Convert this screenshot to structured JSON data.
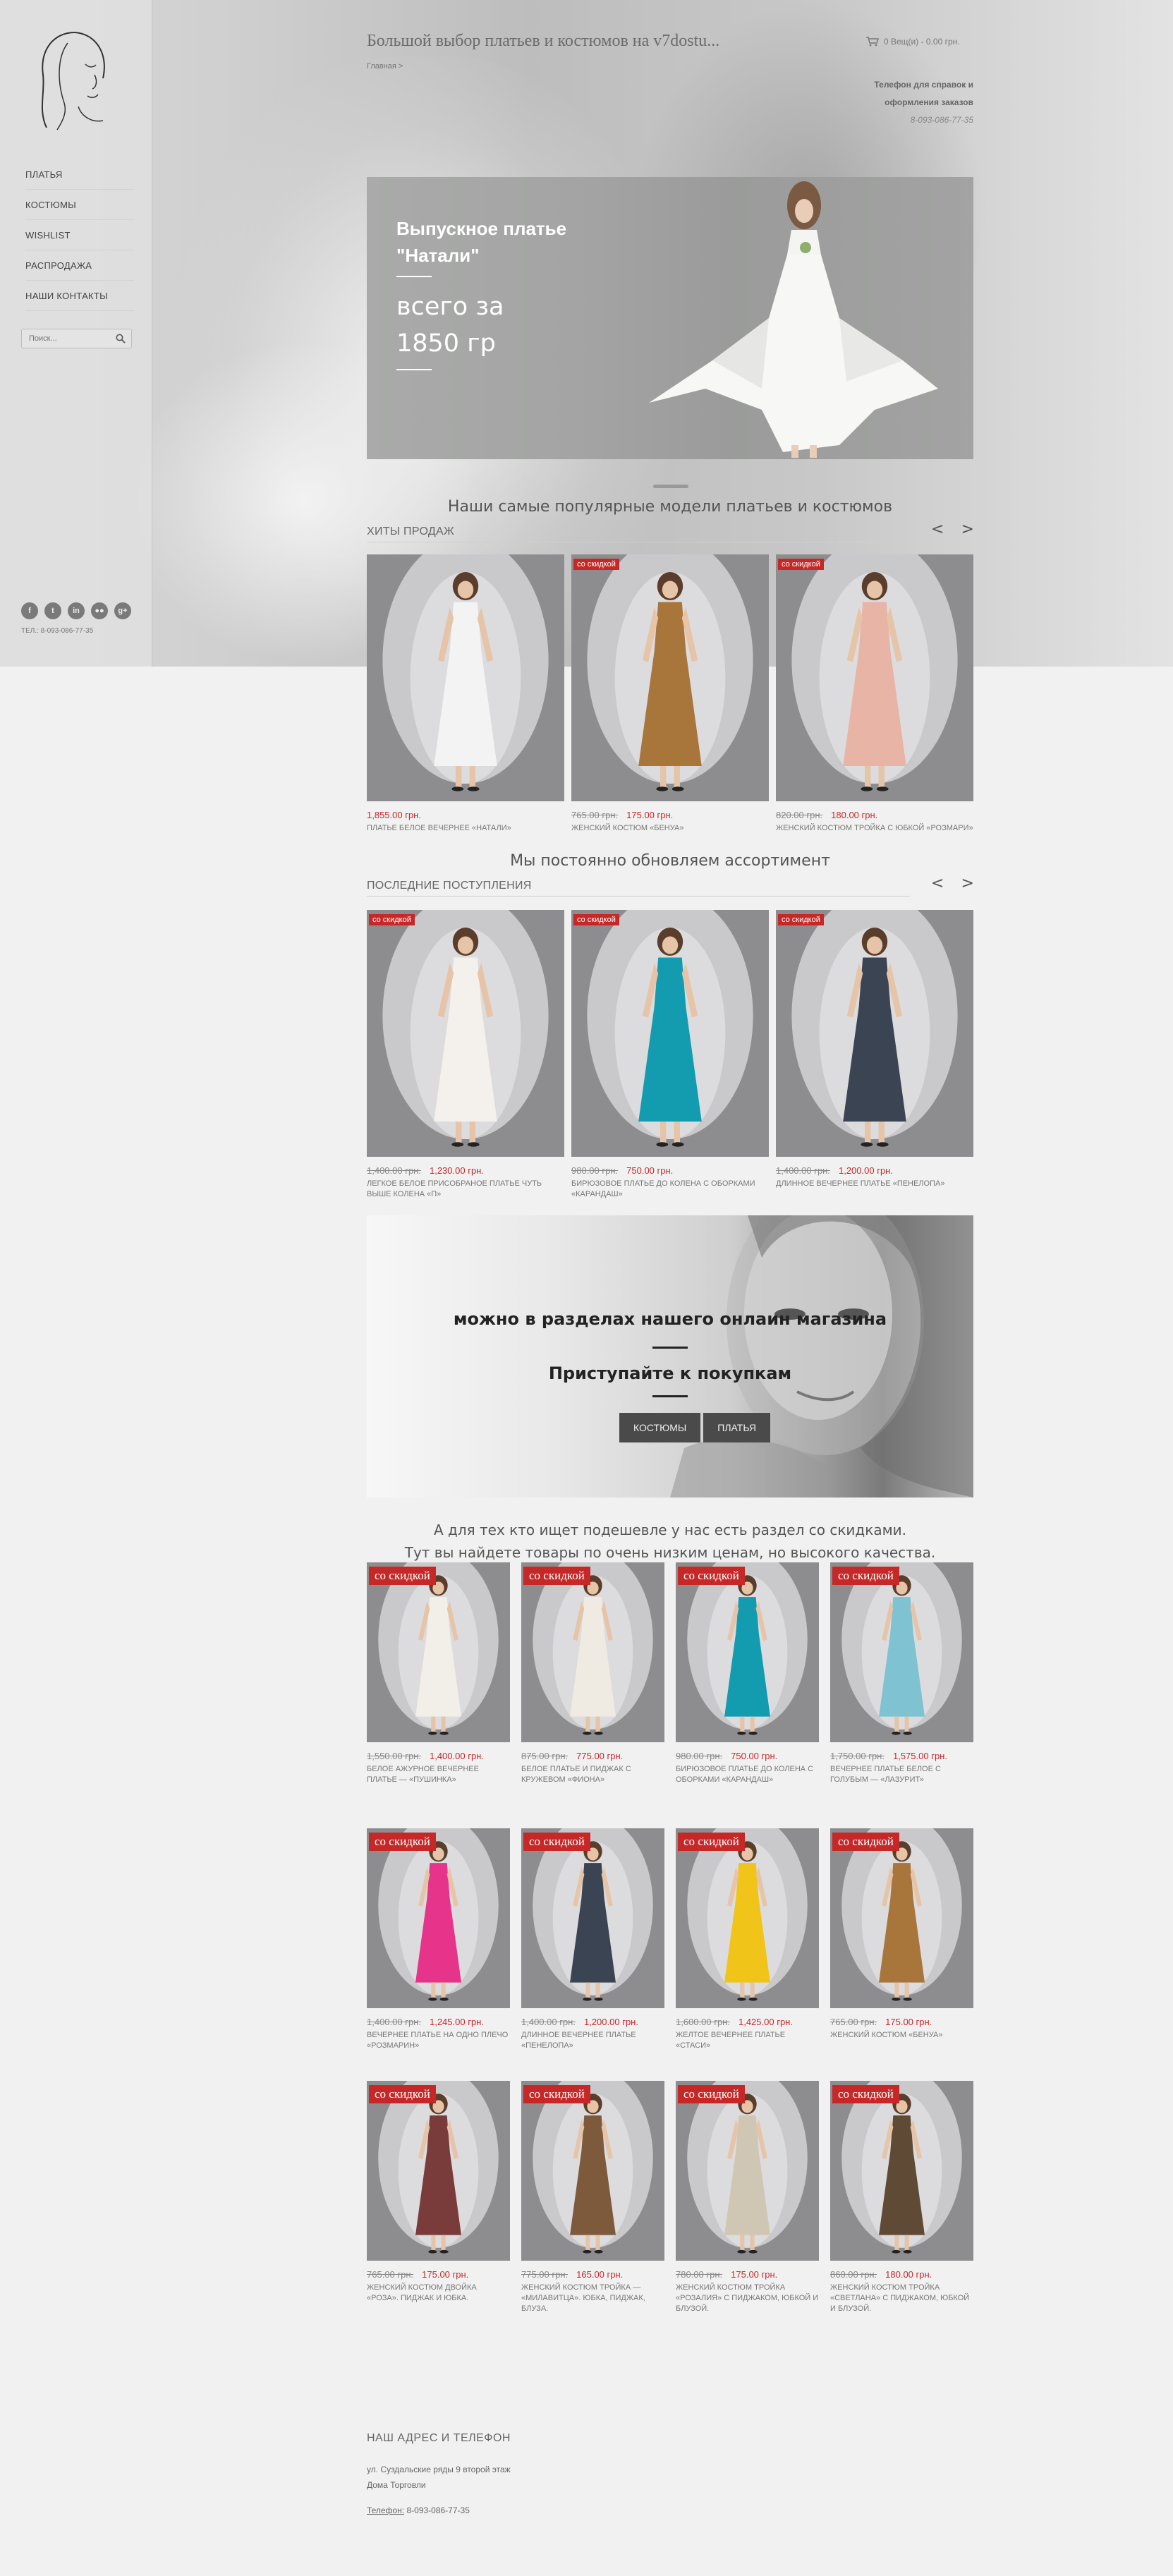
{
  "sidebar": {
    "nav": [
      "ПЛАТЬЯ",
      "КОСТЮМЫ",
      "WISHLIST",
      "РАСПРОДАЖА",
      "НАШИ КОНТАКТЫ"
    ],
    "search_placeholder": "Поиск...",
    "socials": [
      "f",
      "t",
      "in",
      "●●",
      "g+"
    ],
    "phone": "ТЕЛ.: 8-093-086-77-35"
  },
  "header": {
    "title": "Большой выбор платьев и костюмов на v7dostu...",
    "breadcrumb": "Главная  >",
    "cart": "0 Вещ(и) - 0.00 грн.",
    "help_line1": "Телефон для справок и",
    "help_line2": "оформления заказов",
    "help_phone": "8-093-086-77-35"
  },
  "banner": {
    "title_line1": "Выпускное платье",
    "title_line2": "\"Натали\"",
    "price_line1": "всего за",
    "price_line2": "1850 гр"
  },
  "popular": {
    "heading": "Наши самые популярные модели платьев и костюмов",
    "label": "ХИТЫ ПРОДАЖ",
    "items": [
      {
        "badge": "",
        "old": "",
        "price": "1,855.00 грн.",
        "name": "ПЛАТЬЕ БЕЛОЕ ВЕЧЕРНЕЕ «НАТАЛИ»",
        "color": "#f3f3f3"
      },
      {
        "badge": "со скидкой",
        "old": "765.00 грн.",
        "price": "175.00 грн.",
        "name": "ЖЕНСКИЙ КОСТЮМ «БЕНУА»",
        "color": "#a8753a"
      },
      {
        "badge": "со скидкой",
        "old": "820.00 грн.",
        "price": "180.00 грн.",
        "name": "ЖЕНСКИЙ КОСТЮМ ТРОЙКА С ЮБКОЙ «РОЗМАРИ»",
        "color": "#e8b4a6"
      }
    ]
  },
  "latest": {
    "heading": "Мы постоянно обновляем ассортимент",
    "label": "ПОСЛЕДНИЕ ПОСТУПЛЕНИЯ",
    "items": [
      {
        "badge": "со скидкой",
        "old": "1,400.00 грн.",
        "price": "1,230.00 грн.",
        "name": "ЛЕГКОЕ БЕЛОЕ ПРИСОБРАНОЕ ПЛАТЬЕ ЧУТЬ ВЫШЕ КОЛЕНА «П»",
        "color": "#f4f1ec"
      },
      {
        "badge": "со скидкой",
        "old": "980.00 грн.",
        "price": "750.00 грн.",
        "name": "БИРЮЗОВОЕ ПЛАТЬЕ ДО КОЛЕНА С ОБОРКАМИ «КАРАНДАШ»",
        "color": "#139bb0"
      },
      {
        "badge": "со скидкой",
        "old": "1,400.00 грн.",
        "price": "1,200.00 грн.",
        "name": "ДЛИННОЕ ВЕЧЕРНЕЕ ПЛАТЬЕ «ПЕНЕЛОПА»",
        "color": "#3b4452"
      }
    ]
  },
  "promo": {
    "line1": "можно в разделах нашего онлайн магазина",
    "line2": "Приступайте к покупкам",
    "btn1": "КОСТЮМЫ",
    "btn2": "ПЛАТЬЯ"
  },
  "discounts": {
    "heading1": "А для тех кто ищет подешевле у нас есть раздел со скидками.",
    "heading2": "Тут вы найдете товары по очень низким ценам, но высокого качества.",
    "items": [
      {
        "badge": "со скидкой",
        "old": "1,550.00 грн.",
        "price": "1,400.00 грн.",
        "name": "БЕЛОЕ АЖУРНОЕ ВЕЧЕРНЕЕ ПЛАТЬЕ — «ПУШИНКА»",
        "color": "#f2efe8"
      },
      {
        "badge": "со скидкой",
        "old": "875.00 грн.",
        "price": "775.00 грн.",
        "name": "БЕЛОЕ ПЛАТЬЕ И ПИДЖАК С КРУЖЕВОМ «ФИОНА»",
        "color": "#f0ebe2"
      },
      {
        "badge": "со скидкой",
        "old": "980.00 грн.",
        "price": "750.00 грн.",
        "name": "БИРЮЗОВОЕ ПЛАТЬЕ ДО КОЛЕНА С ОБОРКАМИ «КАРАНДАШ»",
        "color": "#139bb0"
      },
      {
        "badge": "со скидкой",
        "old": "1,750.00 грн.",
        "price": "1,575.00 грн.",
        "name": "ВЕЧЕРНЕЕ ПЛАТЬЕ БЕЛОЕ С ГОЛУБЫМ — «ЛАЗУРИТ»",
        "color": "#7fc3d3"
      },
      {
        "badge": "со скидкой",
        "old": "1,400.00 грн.",
        "price": "1,245.00 грн.",
        "name": "ВЕЧЕРНЕЕ ПЛАТЬЕ НА ОДНО ПЛЕЧО «РОЗМАРИН»",
        "color": "#e5348a"
      },
      {
        "badge": "со скидкой",
        "old": "1,400.00 грн.",
        "price": "1,200.00 грн.",
        "name": "ДЛИННОЕ ВЕЧЕРНЕЕ ПЛАТЬЕ «ПЕНЕЛОПА»",
        "color": "#3b4452"
      },
      {
        "badge": "со скидкой",
        "old": "1,600.00 грн.",
        "price": "1,425.00 грн.",
        "name": "ЖЕЛТОЕ ВЕЧЕРНЕЕ ПЛАТЬЕ «СТАСИ»",
        "color": "#f0c419"
      },
      {
        "badge": "со скидкой",
        "old": "765.00 грн.",
        "price": "175.00 грн.",
        "name": "ЖЕНСКИЙ КОСТЮМ «БЕНУА»",
        "color": "#a8753a"
      },
      {
        "badge": "со скидкой",
        "old": "765.00 грн.",
        "price": "175.00 грн.",
        "name": "ЖЕНСКИЙ КОСТЮМ ДВОЙКА «РОЗА». ПИДЖАК И ЮБКА.",
        "color": "#7a3b3b"
      },
      {
        "badge": "со скидкой",
        "old": "775.00 грн.",
        "price": "165.00 грн.",
        "name": "ЖЕНСКИЙ КОСТЮМ ТРОЙКА — «МИЛАВИТЦА». ЮБКА, ПИДЖАК, БЛУЗА.",
        "color": "#7d5a3c"
      },
      {
        "badge": "со скидкой",
        "old": "780.00 грн.",
        "price": "175.00 грн.",
        "name": "ЖЕНСКИЙ КОСТЮМ ТРОЙКА «РОЗАЛИЯ» С ПИДЖАКОМ, ЮБКОЙ И БЛУЗОЙ.",
        "color": "#cfc7b3"
      },
      {
        "badge": "со скидкой",
        "old": "860.00 грн.",
        "price": "180.00 грн.",
        "name": "ЖЕНСКИЙ КОСТЮМ ТРОЙКА «СВЕТЛАНА» С ПИДЖАКОМ, ЮБКОЙ И БЛУЗОЙ.",
        "color": "#5f4a35"
      }
    ]
  },
  "footer": {
    "title": "НАШ АДРЕС И ТЕЛЕФОН",
    "addr1": "ул. Суздальские ряды 9 второй этаж",
    "addr2": "Дома Торговли",
    "phone_label": "Телефон:",
    "phone": "8-093-086-77-35"
  },
  "colors": {
    "accent": "#c62828",
    "text": "#555555",
    "page": "#f1f1f1"
  }
}
